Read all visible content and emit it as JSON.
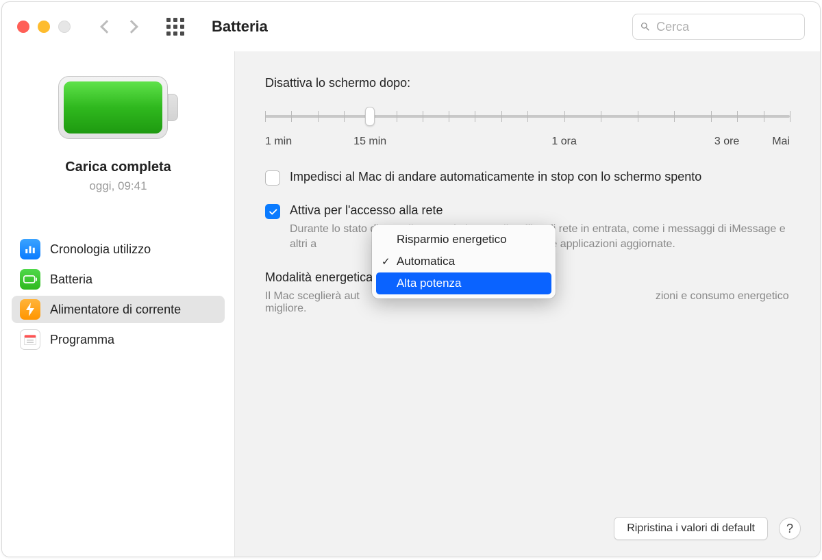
{
  "header": {
    "title": "Batteria",
    "search_placeholder": "Cerca"
  },
  "sidebar": {
    "status_title": "Carica completa",
    "status_sub": "oggi, 09:41",
    "items": [
      {
        "label": "Cronologia utilizzo",
        "icon": "chart-icon",
        "color": "blue"
      },
      {
        "label": "Batteria",
        "icon": "battery-icon",
        "color": "green"
      },
      {
        "label": "Alimentatore di corrente",
        "icon": "bolt-icon",
        "color": "orange"
      },
      {
        "label": "Programma",
        "icon": "calendar-icon",
        "color": "white"
      }
    ],
    "selected_index": 2
  },
  "main": {
    "slider_label": "Disattiva lo schermo dopo:",
    "slider_ticks": [
      "1 min",
      "15 min",
      "1 ora",
      "3 ore",
      "Mai"
    ],
    "slider_value_index": 1,
    "opt1_checked": false,
    "opt1_label": "Impedisci al Mac di andare automaticamente in stop con lo schermo spento",
    "opt2_checked": true,
    "opt2_label": "Attiva per l'accesso alla rete",
    "opt2_desc_a": "Durante lo stato di stop, il Mac può ricevere il traffico di rete in entrata, come i messaggi di iMessage e altri a",
    "opt2_desc_b": "ntenere le applicazioni aggiornate.",
    "energy_label": "Modalità energetica",
    "energy_desc_a": "Il Mac sceglierà aut",
    "energy_desc_b": "zioni e consumo energetico migliore."
  },
  "popup": {
    "items": [
      "Risparmio energetico",
      "Automatica",
      "Alta potenza"
    ],
    "checked_index": 1,
    "highlighted_index": 2
  },
  "footer": {
    "reset_label": "Ripristina i valori di default"
  }
}
